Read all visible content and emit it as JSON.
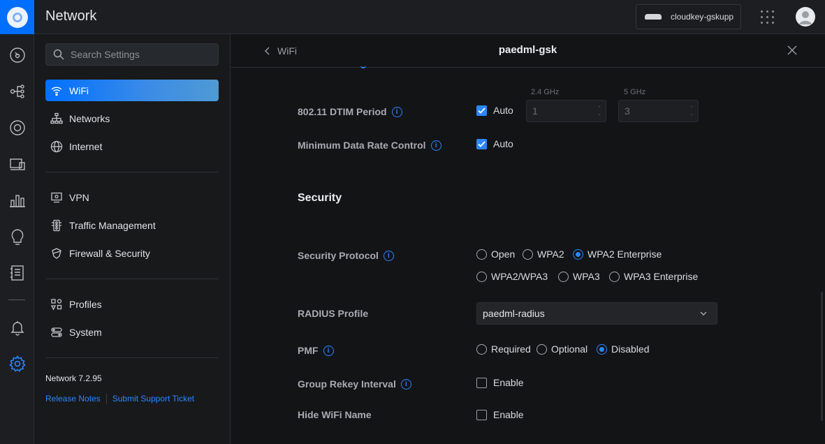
{
  "app": {
    "title": "Network"
  },
  "topbar": {
    "device_name": "cloudkey-gskupp"
  },
  "sidebar": {
    "search_placeholder": "Search Settings",
    "items": [
      {
        "label": "WiFi",
        "icon": "wifi-icon",
        "active": true
      },
      {
        "label": "Networks",
        "icon": "network-tree-icon"
      },
      {
        "label": "Internet",
        "icon": "globe-icon"
      },
      {
        "label": "VPN",
        "icon": "vpn-icon"
      },
      {
        "label": "Traffic Management",
        "icon": "traffic-icon"
      },
      {
        "label": "Firewall & Security",
        "icon": "shield-icon"
      },
      {
        "label": "Profiles",
        "icon": "profiles-icon"
      },
      {
        "label": "System",
        "icon": "system-icon"
      }
    ],
    "version": "Network 7.2.95",
    "release_notes": "Release Notes",
    "support_ticket": "Submit Support Ticket"
  },
  "panel": {
    "back_label": "WiFi",
    "title": "paedml-gsk"
  },
  "dtim": {
    "label": "802.11 DTIM Period",
    "auto_label": "Auto",
    "band_24_label": "2.4 GHz",
    "band_5_label": "5 GHz",
    "value_24": "1",
    "value_5": "3"
  },
  "min_rate": {
    "label": "Minimum Data Rate Control",
    "auto_label": "Auto"
  },
  "security": {
    "title": "Security",
    "protocol_label": "Security Protocol",
    "options": [
      "Open",
      "WPA2",
      "WPA2 Enterprise",
      "WPA2/WPA3",
      "WPA3",
      "WPA3 Enterprise"
    ],
    "selected": "WPA2 Enterprise",
    "radius_label": "RADIUS Profile",
    "radius_value": "paedml-radius",
    "pmf_label": "PMF",
    "pmf_options": [
      "Required",
      "Optional",
      "Disabled"
    ],
    "pmf_selected": "Disabled",
    "rekey_label": "Group Rekey Interval",
    "rekey_enable": "Enable",
    "hide_label": "Hide WiFi Name",
    "hide_enable": "Enable"
  },
  "colors": {
    "accent": "#2c86ff",
    "brand": "#006fff",
    "background": "#131416"
  }
}
